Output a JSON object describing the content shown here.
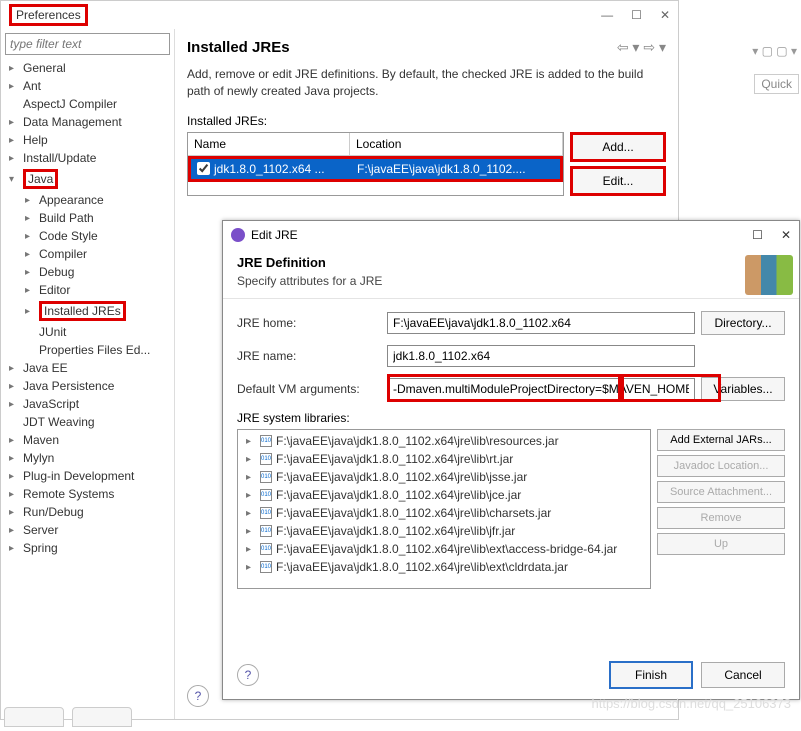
{
  "window": {
    "title": "Preferences",
    "minimize": "—",
    "maximize": "☐",
    "close": "✕"
  },
  "filter_placeholder": "type filter text",
  "tree": {
    "general": "General",
    "ant": "Ant",
    "aspectj": "AspectJ Compiler",
    "datamgmt": "Data Management",
    "help": "Help",
    "install": "Install/Update",
    "java": "Java",
    "java_appearance": "Appearance",
    "java_buildpath": "Build Path",
    "java_codestyle": "Code Style",
    "java_compiler": "Compiler",
    "java_debug": "Debug",
    "java_editor": "Editor",
    "java_installed_jres": "Installed JREs",
    "java_junit": "JUnit",
    "java_propfiles": "Properties Files Ed...",
    "javaee": "Java EE",
    "javapersist": "Java Persistence",
    "javascript": "JavaScript",
    "jdt": "JDT Weaving",
    "maven": "Maven",
    "mylyn": "Mylyn",
    "plugin": "Plug-in Development",
    "remote": "Remote Systems",
    "rundebug": "Run/Debug",
    "server": "Server",
    "spring": "Spring"
  },
  "content": {
    "title": "Installed JREs",
    "desc": "Add, remove or edit JRE definitions. By default, the checked JRE is added to the build path of newly created Java projects.",
    "label": "Installed JREs:",
    "col_name": "Name",
    "col_location": "Location",
    "row_name": "jdk1.8.0_1102.x64 ...",
    "row_location": "F:\\javaEE\\java\\jdk1.8.0_1102....",
    "btn_add": "Add...",
    "btn_edit": "Edit..."
  },
  "edit": {
    "title": "Edit JRE",
    "header_title": "JRE Definition",
    "header_desc": "Specify attributes for a JRE",
    "lbl_home": "JRE home:",
    "val_home": "F:\\javaEE\\java\\jdk1.8.0_1102.x64",
    "btn_dir": "Directory...",
    "lbl_name": "JRE name:",
    "val_name": "jdk1.8.0_1102.x64",
    "lbl_vmargs": "Default VM arguments:",
    "val_vmargs": "-Dmaven.multiModuleProjectDirectory=$MAVEN_HOME",
    "btn_vars": "Variables...",
    "lbl_libs": "JRE system libraries:",
    "libs": [
      "F:\\javaEE\\java\\jdk1.8.0_1102.x64\\jre\\lib\\resources.jar",
      "F:\\javaEE\\java\\jdk1.8.0_1102.x64\\jre\\lib\\rt.jar",
      "F:\\javaEE\\java\\jdk1.8.0_1102.x64\\jre\\lib\\jsse.jar",
      "F:\\javaEE\\java\\jdk1.8.0_1102.x64\\jre\\lib\\jce.jar",
      "F:\\javaEE\\java\\jdk1.8.0_1102.x64\\jre\\lib\\charsets.jar",
      "F:\\javaEE\\java\\jdk1.8.0_1102.x64\\jre\\lib\\jfr.jar",
      "F:\\javaEE\\java\\jdk1.8.0_1102.x64\\jre\\lib\\ext\\access-bridge-64.jar",
      "F:\\javaEE\\java\\jdk1.8.0_1102.x64\\jre\\lib\\ext\\cldrdata.jar"
    ],
    "btn_addjar": "Add External JARs...",
    "btn_javadoc": "Javadoc Location...",
    "btn_srcatt": "Source Attachment...",
    "btn_remove": "Remove",
    "btn_up": "Up",
    "btn_finish": "Finish",
    "btn_cancel": "Cancel"
  },
  "quick": "Quick",
  "watermark": "https://blog.csdn.net/qq_25106373"
}
